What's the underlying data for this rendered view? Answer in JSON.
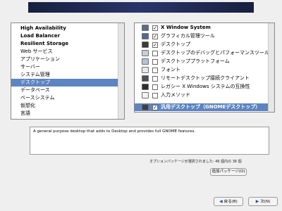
{
  "categories": [
    {
      "label": "High Availability",
      "bold": true
    },
    {
      "label": "Load Balancer",
      "bold": true
    },
    {
      "label": "Resilient Storage",
      "bold": true
    },
    {
      "label": "Web サービス",
      "bold": false
    },
    {
      "label": "アプリケーション",
      "bold": false
    },
    {
      "label": "サーバー",
      "bold": false
    },
    {
      "label": "システム管理",
      "bold": false
    },
    {
      "label": "デスクトップ",
      "bold": false,
      "selected": true
    },
    {
      "label": "データベース",
      "bold": false
    },
    {
      "label": "ベースシステム",
      "bold": false
    },
    {
      "label": "仮想化",
      "bold": false
    },
    {
      "label": "言語",
      "bold": false
    }
  ],
  "packages": [
    {
      "label": "X Window System",
      "checked": true,
      "bold": true,
      "icon": "x-window-icon"
    },
    {
      "label": "グラフィカル管理ツール",
      "checked": true,
      "bold": false,
      "icon": "graphical-admin-icon"
    },
    {
      "label": "デスクトップ",
      "checked": true,
      "bold": false,
      "icon": "desktop-icon"
    },
    {
      "label": "デスクトップのデバッグとパフォーマンスツール",
      "checked": false,
      "bold": false,
      "icon": "debug-tools-icon"
    },
    {
      "label": "デスクトッププラットフォーム",
      "checked": false,
      "bold": false,
      "icon": "platform-icon"
    },
    {
      "label": "フォント",
      "checked": false,
      "bold": false,
      "icon": "font-icon"
    },
    {
      "label": "リモートデスクトップ接続クライアント",
      "checked": false,
      "bold": false,
      "icon": "remote-desktop-icon"
    },
    {
      "label": "レガシー X Windows システムの互換性",
      "checked": false,
      "bold": false,
      "icon": "legacy-x-icon"
    },
    {
      "label": "入力メソッド",
      "checked": false,
      "bold": false,
      "icon": "input-method-icon"
    },
    {
      "label": "汎用デスクトップ（GNOMEデスクトップ）",
      "checked": true,
      "bold": true,
      "selected": true,
      "icon": "gnome-desktop-icon"
    }
  ],
  "description": "A general purpose desktop that adds to Desktop and provides full GNOME features.",
  "status": "オプションパッケージが選択されました: 46 個内の 36 個",
  "buttons": {
    "add_packages": "追加パッケージ(O)",
    "back": "戻る(B)",
    "next": "次(N)"
  }
}
